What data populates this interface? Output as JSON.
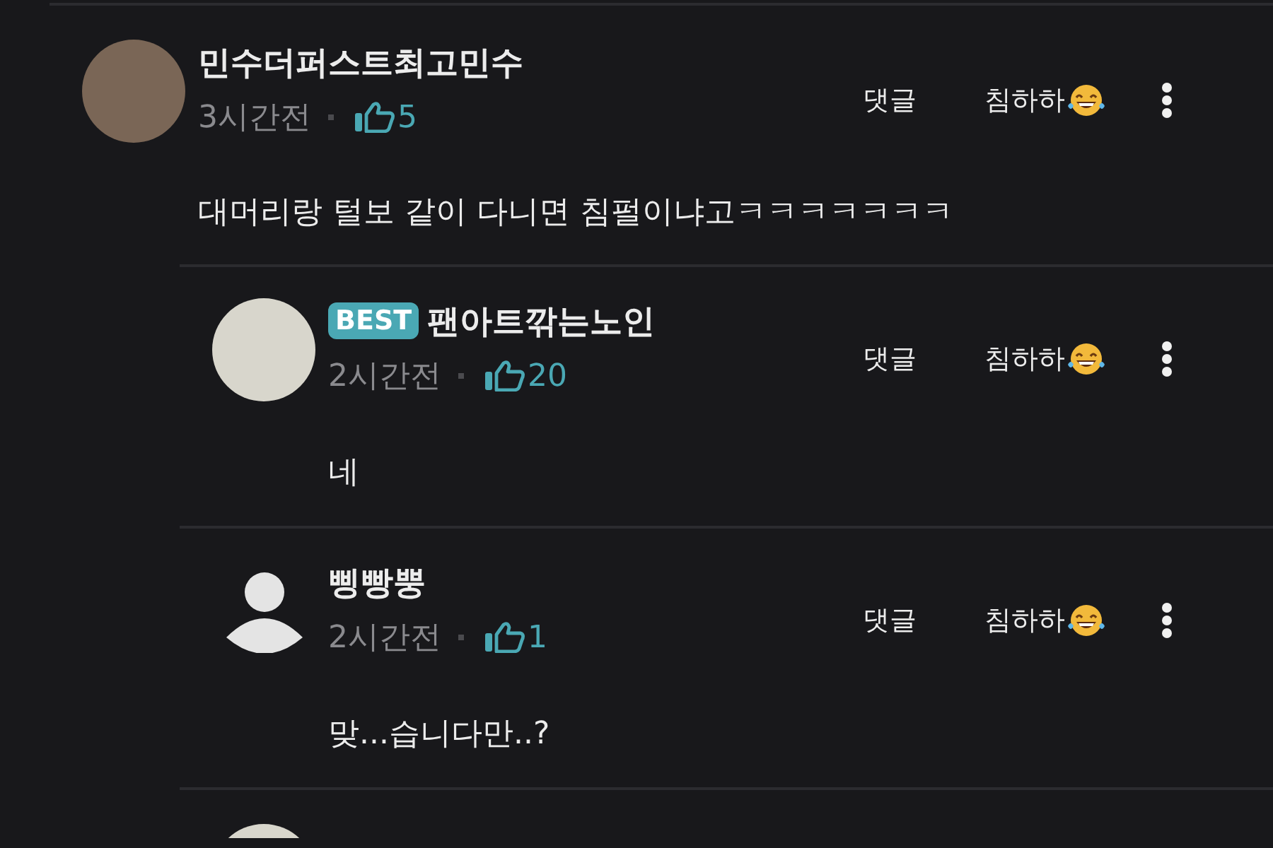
{
  "comments": [
    {
      "kind": "top",
      "avatar": {
        "kind": "photo"
      },
      "author": "민수더퍼스트최고민수",
      "time": "3시간전",
      "likes": "5",
      "body": "대머리랑 털보 같이 다니면 침펄이냐고ㅋㅋㅋㅋㅋㅋㅋ",
      "reply_label": "댓글",
      "react_label": "침하하"
    },
    {
      "kind": "reply",
      "avatar": {
        "kind": "photo"
      },
      "badge": "BEST",
      "author": "팬아트깎는노인",
      "time": "2시간전",
      "likes": "20",
      "body": "네",
      "reply_label": "댓글",
      "react_label": "침하하"
    },
    {
      "kind": "reply",
      "avatar": {
        "kind": "default"
      },
      "author": "삥빵뿡",
      "time": "2시간전",
      "likes": "1",
      "body": "맞...습니다만..?",
      "reply_label": "댓글",
      "react_label": "침하하"
    }
  ],
  "partial_reply": {
    "kind": "reply",
    "avatar": {
      "kind": "photo"
    }
  }
}
